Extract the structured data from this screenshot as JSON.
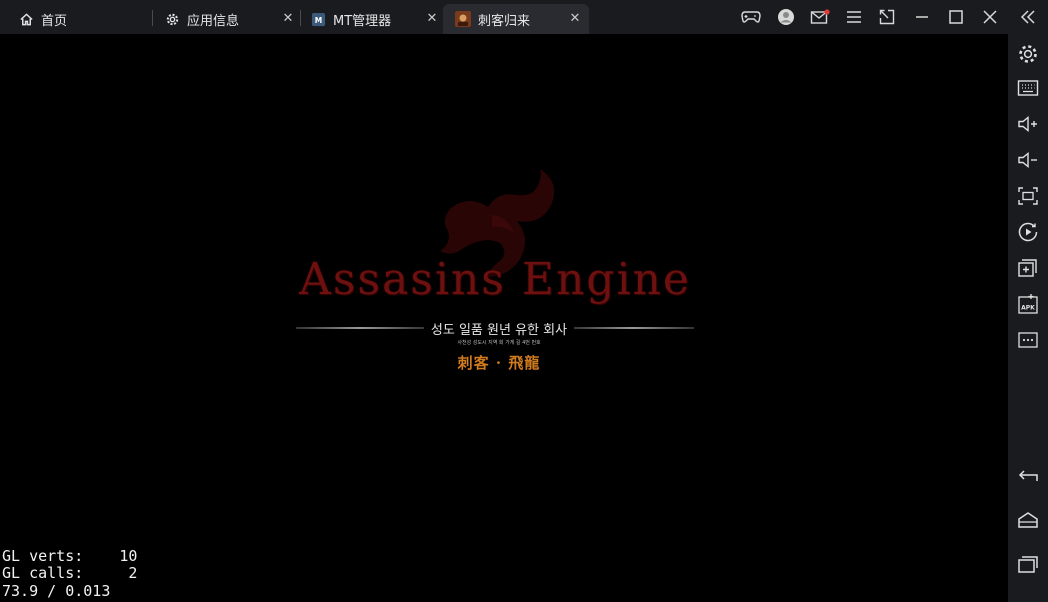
{
  "tabs": [
    {
      "label": "首页",
      "icon": "home-icon",
      "active": false
    },
    {
      "label": "应用信息",
      "icon": "gear-icon",
      "active": false
    },
    {
      "label": "MT管理器",
      "icon": "mt-app-icon",
      "active": false
    },
    {
      "label": "刺客归来",
      "icon": "game-app-icon",
      "active": true
    }
  ],
  "close_glyph": "✕",
  "window_controls": [
    "gamepad-icon",
    "user-avatar-icon",
    "mail-icon",
    "menu-icon",
    "external-window-icon",
    "minimize-icon",
    "maximize-icon",
    "close-icon",
    "collapse-sidebar-icon"
  ],
  "game": {
    "logo_title": "Assasins Engine",
    "logo_subtitle": "성도 일품 원년 유한 회사",
    "logo_small_text": "사천성 성도시 지역 회 가게 길 4번 번호",
    "logo_chinese": "刺客 · 飛龍",
    "debug": {
      "line1": "GL verts:    10",
      "line2": "GL calls:     2",
      "line3": "73.9 / 0.013"
    }
  },
  "sidebar": {
    "top_items": [
      "settings-icon",
      "keyboard-icon",
      "volume-up-icon",
      "volume-down-icon",
      "screenshot-icon",
      "record-icon",
      "multi-instance-icon",
      "apk-install-icon",
      "more-icon"
    ],
    "bottom_items": [
      "back-icon",
      "home-button-icon",
      "recent-apps-icon"
    ]
  },
  "colors": {
    "chrome": "#1a1b1f",
    "active_tab": "#2a2b30",
    "logo_red": "#6d1010",
    "logo_orange": "#d07a1e"
  }
}
